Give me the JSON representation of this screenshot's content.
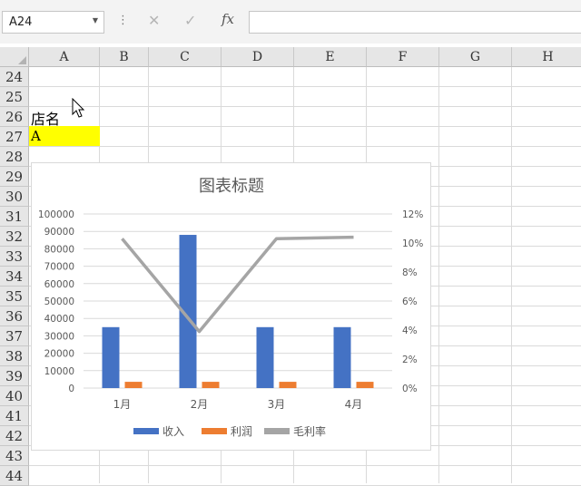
{
  "formula_bar": {
    "name_box": "A24",
    "fx_label": "fx",
    "formula": ""
  },
  "columns": [
    "A",
    "B",
    "C",
    "D",
    "E",
    "F",
    "G",
    "H"
  ],
  "rows": [
    "24",
    "25",
    "26",
    "27",
    "28",
    "29",
    "30",
    "31",
    "32",
    "33",
    "34",
    "35",
    "36",
    "37",
    "38",
    "39",
    "40",
    "41",
    "42",
    "43",
    "44"
  ],
  "cells": {
    "a26": "店名",
    "a27": "A"
  },
  "colors": {
    "highlight": "#ffff00",
    "revenue": "#4472c4",
    "profit": "#ed7d31",
    "margin": "#a5a5a5"
  },
  "chart_data": {
    "type": "bar",
    "title": "图表标题",
    "categories": [
      "1月",
      "2月",
      "3月",
      "4月"
    ],
    "series": [
      {
        "name": "收入",
        "kind": "bar",
        "axis": "left",
        "values": [
          35000,
          88000,
          35000,
          35000
        ]
      },
      {
        "name": "利润",
        "kind": "bar",
        "axis": "left",
        "values": [
          3600,
          3600,
          3600,
          3600
        ]
      },
      {
        "name": "毛利率",
        "kind": "line",
        "axis": "right",
        "values": [
          0.103,
          0.039,
          0.103,
          0.104
        ]
      }
    ],
    "left_axis": {
      "min": 0,
      "max": 100000,
      "ticks": [
        "0",
        "10000",
        "20000",
        "30000",
        "40000",
        "50000",
        "60000",
        "70000",
        "80000",
        "90000",
        "100000"
      ]
    },
    "right_axis": {
      "min": 0,
      "max": 0.12,
      "ticks": [
        "0%",
        "2%",
        "4%",
        "6%",
        "8%",
        "10%",
        "12%"
      ]
    },
    "grid": true,
    "legend_position": "bottom"
  }
}
